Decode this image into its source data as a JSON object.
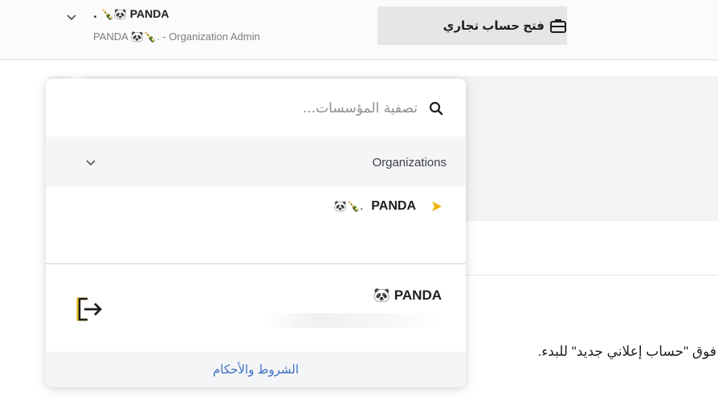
{
  "header": {
    "account_name": "PANDA",
    "account_name_emoji": ". 🍾🐼",
    "account_subtitle": "PANDA 🐼🍾. - Organization Admin",
    "open_business_label": "فتح حساب تجاري"
  },
  "dropdown": {
    "search_placeholder": "تصفية المؤسسات...",
    "organizations_label": "Organizations",
    "organization_item": {
      "name": "PANDA",
      "emoji": "🐼🍾."
    },
    "user_name": "🐼 PANDA",
    "terms_link": "الشروط والأحكام"
  },
  "page": {
    "instruction_text": "فوق \"حساب إعلاني جديد\" للبدء."
  },
  "colors": {
    "accent": "#3b6fc4",
    "play_icon": "#f0b400",
    "logout_icon": "#e5b813"
  },
  "icons": {
    "account_chevron": "chevron-down-icon",
    "briefcase": "briefcase-icon",
    "search": "search-icon",
    "org_chevron": "chevron-down-icon",
    "play": "play-icon",
    "logout": "logout-icon"
  }
}
